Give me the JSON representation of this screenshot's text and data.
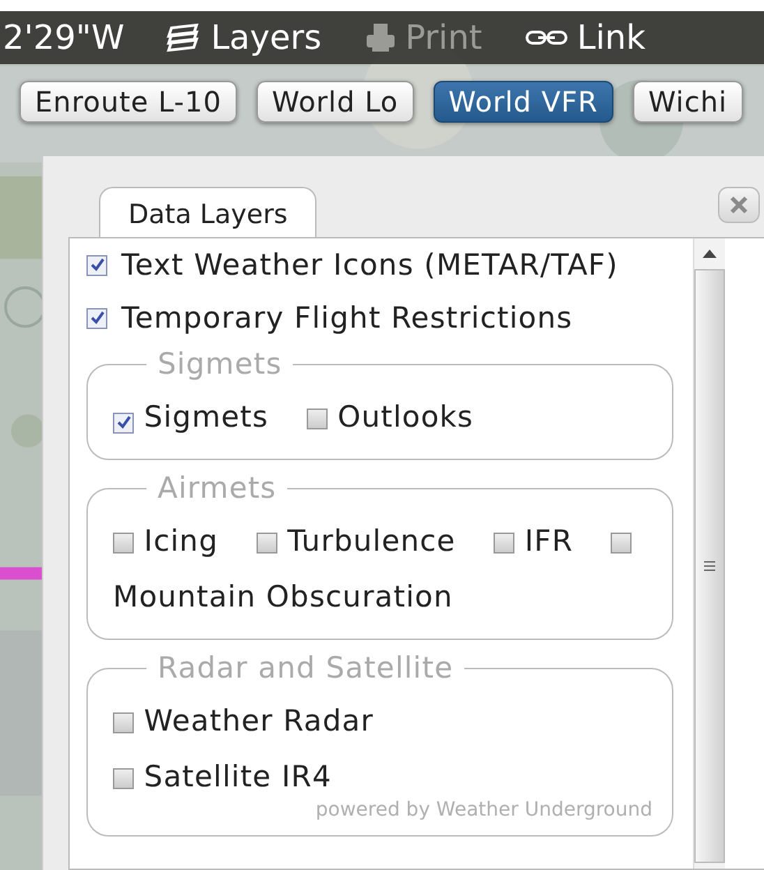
{
  "toolbar": {
    "coordinate": "2'29\"W",
    "items": [
      {
        "kind": "layers",
        "label": "Layers",
        "disabled": false
      },
      {
        "kind": "print",
        "label": "Print",
        "disabled": true
      },
      {
        "kind": "link",
        "label": "Link",
        "disabled": false
      }
    ]
  },
  "chart_buttons": [
    {
      "label": "Enroute L-10",
      "selected": false
    },
    {
      "label": "World Lo",
      "selected": false
    },
    {
      "label": "World VFR",
      "selected": true
    },
    {
      "label": "Wichi",
      "selected": false
    }
  ],
  "panel": {
    "tab": "Data Layers",
    "layers": [
      {
        "label": "Text Weather Icons (METAR/TAF)",
        "checked": true
      },
      {
        "label": "Temporary Flight Restrictions",
        "checked": true
      }
    ],
    "groups": [
      {
        "legend": "Sigmets",
        "kind": "flow",
        "options": [
          {
            "label": "Sigmets",
            "checked": true
          },
          {
            "label": "Outlooks",
            "checked": false
          }
        ]
      },
      {
        "legend": "Airmets",
        "kind": "flow",
        "options": [
          {
            "label": "Icing",
            "checked": false
          },
          {
            "label": "Turbulence",
            "checked": false
          },
          {
            "label": "IFR",
            "checked": false
          },
          {
            "label": "Mountain Obscuration",
            "checked": false
          }
        ]
      },
      {
        "legend": "Radar and Satellite",
        "kind": "stack",
        "options": [
          {
            "label": "Weather Radar",
            "checked": false
          },
          {
            "label": "Satellite IR4",
            "checked": false
          }
        ],
        "credit": "powered by Weather Underground"
      }
    ]
  }
}
